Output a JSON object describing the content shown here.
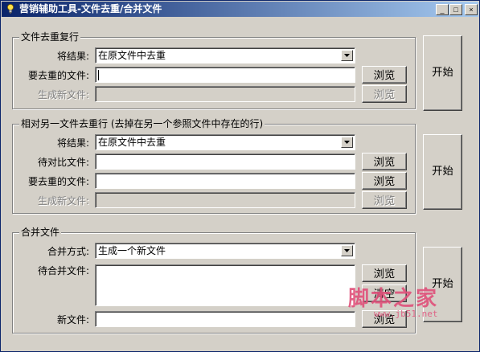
{
  "window": {
    "title": "营销辅助工具-文件去重/合并文件",
    "minimize": "_",
    "maximize": "□",
    "close": "×"
  },
  "section1": {
    "title": "文件去重复行",
    "result_label": "将结果:",
    "result_value": "在原文件中去重",
    "dedupe_label": "要去重的文件:",
    "dedupe_value": "",
    "output_label": "生成新文件:",
    "output_value": "",
    "browse_label": "浏览",
    "browse_disabled_label": "浏览",
    "start_label": "开始"
  },
  "section2": {
    "title": "相对另一文件去重行 (去掉在另一个参照文件中存在的行)",
    "result_label": "将结果:",
    "result_value": "在原文件中去重",
    "compare_label": "待对比文件:",
    "compare_value": "",
    "dedupe_label": "要去重的文件:",
    "dedupe_value": "",
    "output_label": "生成新文件:",
    "output_value": "",
    "browse1_label": "浏览",
    "browse2_label": "浏览",
    "browse3_label": "浏览",
    "start_label": "开始"
  },
  "section3": {
    "title": "合并文件",
    "mode_label": "合并方式:",
    "mode_value": "生成一个新文件",
    "files_label": "待合并文件:",
    "files_value": "",
    "newfile_label": "新文件:",
    "newfile_value": "",
    "browse_label": "浏览",
    "clear_label": "清空",
    "browse2_label": "浏览",
    "start_label": "开始"
  },
  "watermark": {
    "text": "脚本之家",
    "url": "www.jb51.net",
    "color": "#e0507a"
  }
}
